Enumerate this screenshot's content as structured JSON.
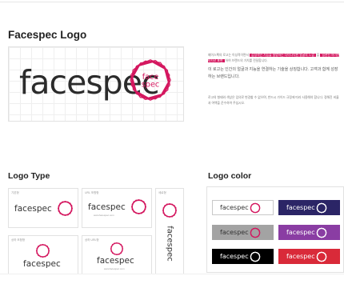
{
  "title": "Facespec Logo",
  "brand": {
    "wordmark": "facespec",
    "mark_line1": "face",
    "mark_line2": "spec",
    "url": "www.facespec.com",
    "accent": "#d4175f"
  },
  "description": {
    "p1_pre": "페이스펙의 로고는 이성적이면서",
    "p1_highlight1": "감성적인 기능을 설명하는 다이나믹한 얼굴의 느낌",
    "p1_mid": "을 ",
    "p1_highlight2": "일관된 아이덴티티로 표현",
    "p1_post": "하여 브랜드의 가치를 전달합니다.",
    "p2": "이 로고는 인간의 얼굴과 지능을 연결하는 기술을 상징합니다. 고객과 함께 성장하는 브랜드입니다.",
    "p3": "로고의 형태와 색상은 임의로 변경할 수 없으며, 반드시 가이드 규정에 따라 사용해야 합니다. 정해진 비율과 여백을 준수하여 주십시오."
  },
  "sections": {
    "logo_type": "Logo Type",
    "logo_color": "Logo color"
  },
  "logo_types": [
    {
      "label": "기본형"
    },
    {
      "label": "URL 포함형"
    },
    {
      "label": "세로형"
    },
    {
      "label": "상하 조합형"
    },
    {
      "label": "상하 URL형"
    }
  ],
  "logo_colors": [
    {
      "bg": "#ffffff",
      "fg": "#333333",
      "mark": "#d4175f",
      "border": "#c9c9c9"
    },
    {
      "bg": "#2b2566",
      "fg": "#ffffff",
      "mark": "#ffffff",
      "border": "#2b2566"
    },
    {
      "bg": "#a3a3a3",
      "fg": "#333333",
      "mark": "#d4175f",
      "border": "#a3a3a3"
    },
    {
      "bg": "#8a3da3",
      "fg": "#ffffff",
      "mark": "#ffffff",
      "border": "#8a3da3"
    },
    {
      "bg": "#000000",
      "fg": "#ffffff",
      "mark": "#ffffff",
      "border": "#000000"
    },
    {
      "bg": "#d92a39",
      "fg": "#ffffff",
      "mark": "#ffffff",
      "border": "#d92a39"
    }
  ]
}
